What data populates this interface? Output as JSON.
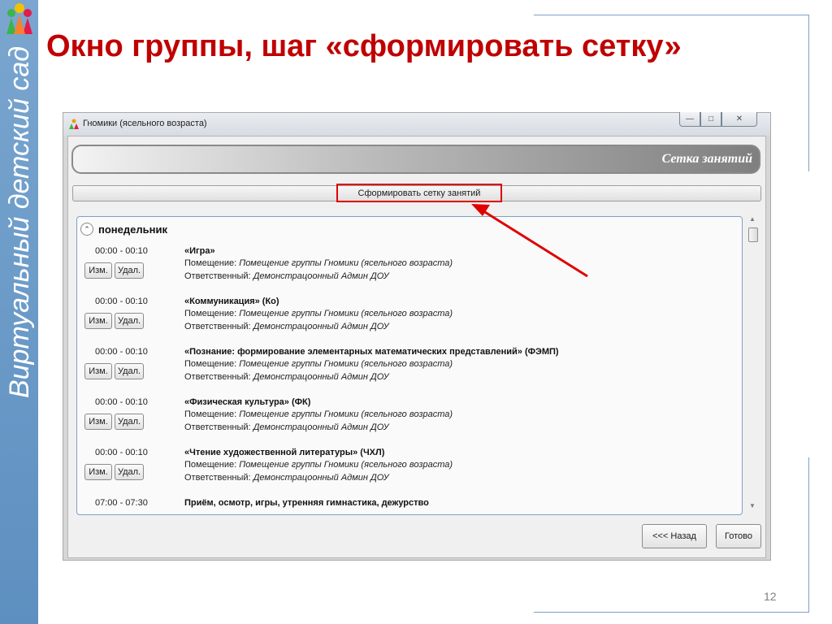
{
  "slide": {
    "title": "Окно группы, шаг «сформировать сетку»",
    "side_text": "Виртуальный детский сад",
    "page_number": "12"
  },
  "window": {
    "title": "Гномики (ясельного возраста)",
    "controls": {
      "minimize": "—",
      "maximize": "□",
      "close": "✕"
    },
    "header": "Сетка занятий",
    "form_grid_button": "Сформировать сетку занятий",
    "day": "понедельник",
    "edit_label": "Изм.",
    "delete_label": "Удал.",
    "room_label": "Помещение:",
    "responsible_label": "Ответственный:",
    "lessons": [
      {
        "time": "00:00 - 00:10",
        "name": "«Игра»",
        "room": "Помещение группы Гномики (ясельного возраста)",
        "responsible": "Демонстрацоонный Админ ДОУ"
      },
      {
        "time": "00:00 - 00:10",
        "name": "«Коммуникация» (Ко)",
        "room": "Помещение группы Гномики (ясельного возраста)",
        "responsible": "Демонстрацоонный Админ ДОУ"
      },
      {
        "time": "00:00 - 00:10",
        "name": "«Познание: формирование элементарных математических представлений» (ФЭМП)",
        "room": "Помещение группы Гномики (ясельного возраста)",
        "responsible": "Демонстрацоонный Админ ДОУ"
      },
      {
        "time": "00:00 - 00:10",
        "name": "«Физическая культура» (ФК)",
        "room": "Помещение группы Гномики (ясельного возраста)",
        "responsible": "Демонстрацоонный Админ ДОУ"
      },
      {
        "time": "00:00 - 00:10",
        "name": "«Чтение художественной литературы» (ЧХЛ)",
        "room": "Помещение группы Гномики (ясельного возраста)",
        "responsible": "Демонстрацоонный Админ ДОУ"
      },
      {
        "time": "07:00 - 07:30",
        "name": "Приём, осмотр, игры, утренняя гимнастика, дежурство"
      }
    ],
    "back_button": "<<< Назад",
    "done_button": "Готово"
  },
  "colors": {
    "title_red": "#c00000",
    "side_band": "#5d8fc0",
    "highlight_red": "#e00000"
  },
  "icons": [
    "kindergarten-logo-icon",
    "children-app-icon",
    "chevron-up-icon",
    "red-arrow"
  ]
}
